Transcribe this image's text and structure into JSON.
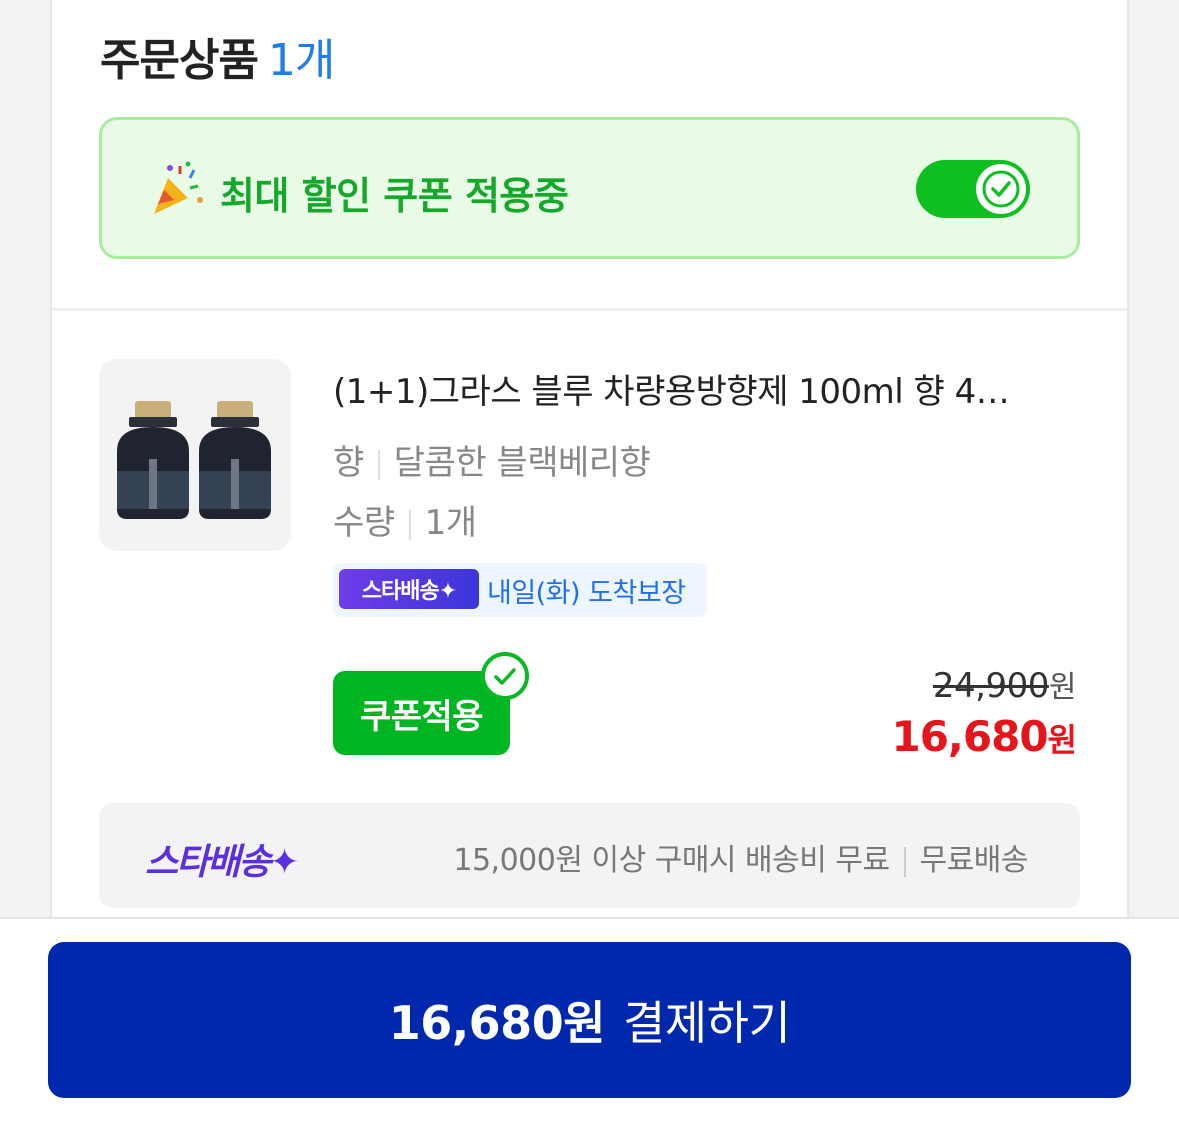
{
  "order": {
    "title": "주문상품",
    "count": "1개"
  },
  "coupon_banner": {
    "icon": "party-popper-icon",
    "text": "최대 할인 쿠폰 적용중",
    "toggle_on": true
  },
  "product": {
    "title": "(1+1)그라스 블루 차량용방향제 100ml 향 4…",
    "options": [
      {
        "label": "향",
        "value": "달콤한 블랙베리향"
      },
      {
        "label": "수량",
        "value": "1개"
      }
    ],
    "delivery_badge": "스타배송✦",
    "delivery_text": "내일(화) 도착보장",
    "coupon_button": "쿠폰적용",
    "original_price": "24,900",
    "sale_price": "16,680",
    "currency": "원"
  },
  "shipping": {
    "logo": "스타배송✦",
    "condition": "15,000원 이상 구매시 배송비 무료",
    "fee": "무료배송"
  },
  "pay": {
    "amount": "16,680원",
    "label": "결제하기"
  },
  "colors": {
    "accent_blue": "#0028ad",
    "green": "#00b522",
    "sale_red": "#e6151b",
    "count_blue": "#1f7bf0"
  }
}
